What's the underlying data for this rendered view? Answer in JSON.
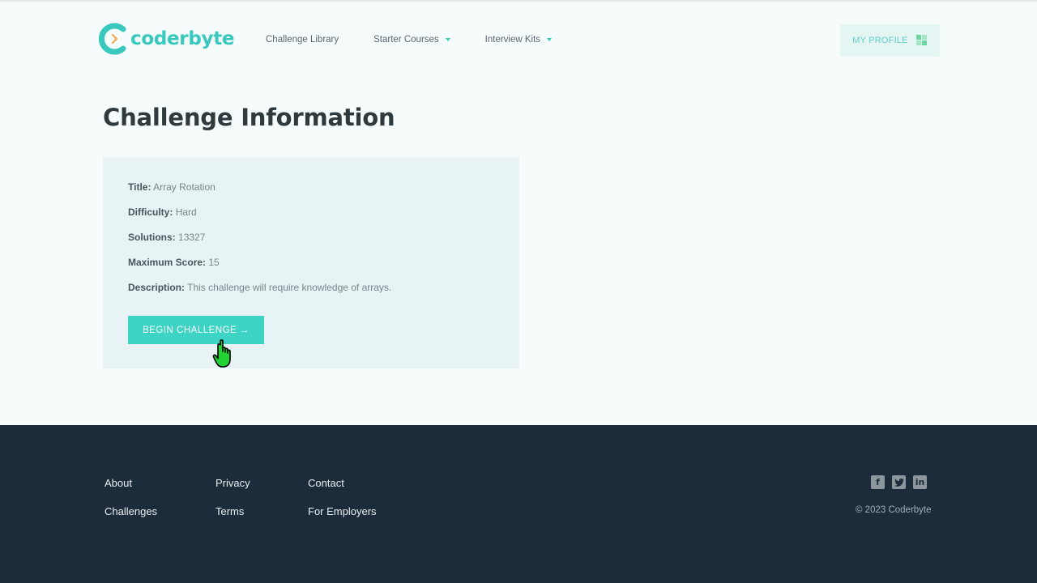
{
  "header": {
    "logo_text": "coderbyte",
    "nav": [
      {
        "label": "Challenge Library",
        "has_dropdown": false
      },
      {
        "label": "Starter Courses",
        "has_dropdown": true
      },
      {
        "label": "Interview Kits",
        "has_dropdown": true
      }
    ],
    "profile_label": "MY PROFILE"
  },
  "main": {
    "title": "Challenge Information",
    "fields": [
      {
        "label": "Title:",
        "value": "Array Rotation"
      },
      {
        "label": "Difficulty:",
        "value": "Hard"
      },
      {
        "label": "Solutions:",
        "value": "13327"
      },
      {
        "label": "Maximum Score:",
        "value": "15"
      },
      {
        "label": "Description:",
        "value": "This challenge will require knowledge of arrays."
      }
    ],
    "begin_button": "BEGIN CHALLENGE →"
  },
  "footer": {
    "links": [
      "About",
      "Privacy",
      "Contact",
      "Challenges",
      "Terms",
      "For Employers"
    ],
    "social_icons": [
      "facebook-icon",
      "twitter-icon",
      "linkedin-icon"
    ],
    "copyright": "© 2023 Coderbyte"
  },
  "colors": {
    "accent": "#3dd3c5",
    "footer_bg": "#1d2c3a",
    "card_bg": "#e8f3f5",
    "page_bg": "#f6fbfc"
  }
}
